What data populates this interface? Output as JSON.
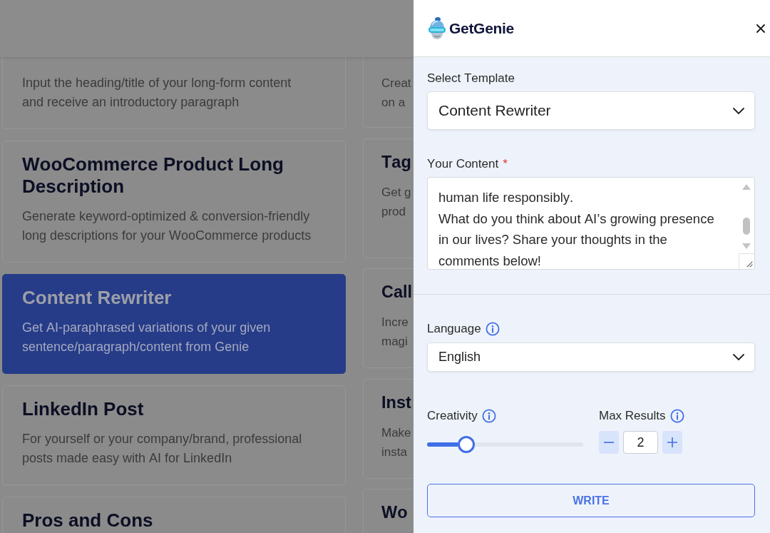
{
  "background_page": {
    "left_column_cards": [
      {
        "description": "Input the heading/title of your long-form content and receive an introductory paragraph",
        "selected": false
      },
      {
        "title": "WooCommerce Product Long Description",
        "description": "Generate keyword-optimized & conversion-friendly long descriptions for your WooCommerce products",
        "selected": false
      },
      {
        "title": "Content Rewriter",
        "description": "Get AI-paraphrased variations of your given sentence/paragraph/content from Genie",
        "selected": true
      },
      {
        "title": "LinkedIn Post",
        "description": "For yourself or your company/brand, professional posts made easy with AI for LinkedIn",
        "selected": false
      },
      {
        "title": "Pros and Cons",
        "selected": false
      }
    ],
    "right_column_cards": [
      {
        "description_lines": [
          "Creat",
          "on a"
        ],
        "selected": false
      },
      {
        "title": "Tag",
        "description_lines": [
          "Get g",
          "prod"
        ],
        "selected": false
      },
      {
        "title": "Call",
        "description_lines": [
          "Incre",
          "magi"
        ],
        "selected": false
      },
      {
        "title": "Inst",
        "description_lines": [
          "Make",
          "insta"
        ],
        "selected": false
      },
      {
        "title": "Wo",
        "selected": false
      }
    ]
  },
  "panel": {
    "brand": "GetGenie",
    "template_field": {
      "label": "Select Template",
      "value": "Content Rewriter"
    },
    "content_field": {
      "label": "Your Content",
      "required_mark": "*",
      "value": "human life responsibly.\nWhat do you think about AI’s growing presence in our lives? Share your thoughts in the comments below!"
    },
    "language_field": {
      "label": "Language",
      "value": "English"
    },
    "creativity": {
      "label": "Creativity",
      "level": 0.25
    },
    "max_results": {
      "label": "Max Results",
      "value": "2"
    },
    "write_button": {
      "label": "WRITE"
    }
  }
}
